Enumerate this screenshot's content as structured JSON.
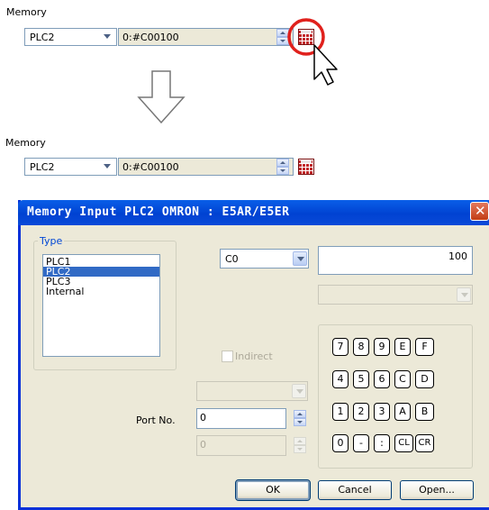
{
  "top_section": {
    "memory_label": "Memory",
    "plc_select": "PLC2",
    "address_value": "0:#C00100"
  },
  "bottom_section": {
    "memory_label": "Memory",
    "plc_select": "PLC2",
    "address_value": "0:#C00100"
  },
  "dialog": {
    "title": "Memory Input  PLC2 OMRON : E5AR/E5ER",
    "type_group_title": "Type",
    "type_items": [
      "PLC1",
      "PLC2",
      "PLC3",
      "Internal"
    ],
    "type_selected": "PLC2",
    "memory_type_select": "C0",
    "value_field": "100",
    "indirect_label": "Indirect",
    "port_label": "Port No.",
    "port_value": "0",
    "port_disabled_value": "0",
    "keypad_rows": [
      [
        "7",
        "8",
        "9",
        "E",
        "F"
      ],
      [
        "4",
        "5",
        "6",
        "C",
        "D"
      ],
      [
        "1",
        "2",
        "3",
        "A",
        "B"
      ],
      [
        "0",
        "-",
        ":",
        "CL",
        "CR"
      ]
    ],
    "ok_label": "OK",
    "cancel_label": "Cancel",
    "open_label": "Open..."
  },
  "colors": {
    "title_bar": "#0042d2",
    "selection": "#316ac5",
    "highlight_circle": "#e0201c",
    "group_title": "#0046d5"
  },
  "icons": {
    "calculator": "calculator-icon",
    "cursor": "mouse-pointer-icon",
    "arrow": "down-arrow-icon"
  }
}
